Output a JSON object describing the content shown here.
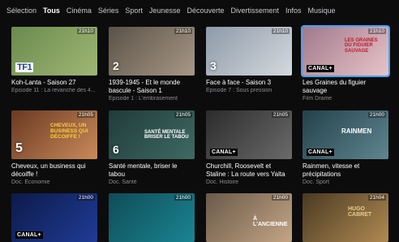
{
  "nav": [
    "Sélection",
    "Tous",
    "Cinéma",
    "Séries",
    "Sport",
    "Jeunesse",
    "Découverte",
    "Divertissement",
    "Infos",
    "Musique"
  ],
  "active_nav": "Tous",
  "cards": [
    {
      "time": "21h10",
      "channel": "TF1",
      "title": "Koh-Lanta - Saison 27",
      "subtitle": "Episode 11 : La revanche des 4...",
      "overlay": "",
      "colors": [
        "#6b8a4e",
        "#9fb774"
      ],
      "progress": 0
    },
    {
      "time": "21h10",
      "channel": "2",
      "title": "1939-1945 - Et le monde bascule - Saison 1",
      "subtitle": "Episode 1 : L'embrasement",
      "overlay": "",
      "colors": [
        "#5a5248",
        "#a89886"
      ],
      "progress": 0
    },
    {
      "time": "21h10",
      "channel": "3",
      "title": "Face à face - Saison 3",
      "subtitle": "Episode 7 : Sous pression",
      "overlay": "",
      "colors": [
        "#8d9aa8",
        "#d5d9df"
      ],
      "progress": 0
    },
    {
      "time": "21h10",
      "channel": "CANAL+",
      "title": "Les Graines du figuier sauvage",
      "subtitle": "Film Drame",
      "overlay": "Les graines du figuier sauvage",
      "colors": [
        "#a07a8a",
        "#e9c3c9"
      ],
      "progress": 0
    },
    {
      "time": "21h05",
      "channel": "5",
      "title": "Cheveux, un business qui décoiffe !",
      "subtitle": "Doc. Economie",
      "overlay": "Cheveux, un business qui décoiffe !",
      "colors": [
        "#6b3a22",
        "#c98a5a"
      ],
      "progress": 0
    },
    {
      "time": "21h05",
      "channel": "6",
      "title": "Santé mentale, briser le tabou",
      "subtitle": "Doc. Santé",
      "overlay": "Santé mentale briser le tabou",
      "colors": [
        "#213b3b",
        "#3e6a63"
      ],
      "progress": 0
    },
    {
      "time": "21h05",
      "channel": "CANAL+",
      "title": "Churchill, Roosevelt et Staline : La route vers Yalta",
      "subtitle": "Doc. Histoire",
      "overlay": "",
      "colors": [
        "#2c2c2c",
        "#6a6a6a"
      ],
      "progress": 0
    },
    {
      "time": "21h00",
      "channel": "CANAL+",
      "title": "Rainmen, vitesse et précipitations",
      "subtitle": "Doc. Sport",
      "overlay": "Rainmen",
      "colors": [
        "#24414a",
        "#5f8691"
      ],
      "progress": 0
    },
    {
      "time": "21h00",
      "channel": "CANAL+",
      "title": "",
      "subtitle": "",
      "overlay": "",
      "colors": [
        "#0d1a4a",
        "#1f3c96"
      ],
      "progress": 0
    },
    {
      "time": "21h00",
      "channel": "",
      "title": "",
      "subtitle": "",
      "overlay": "",
      "colors": [
        "#0f4c56",
        "#1a8592"
      ],
      "progress": 0
    },
    {
      "time": "21h00",
      "channel": "",
      "title": "",
      "subtitle": "",
      "overlay": "À l'ancienne",
      "colors": [
        "#6a5a4a",
        "#c4a584"
      ],
      "progress": 0
    },
    {
      "time": "21h04",
      "channel": "",
      "title": "",
      "subtitle": "",
      "overlay": "Hugo Cabret",
      "colors": [
        "#4a3a22",
        "#b08a52"
      ],
      "progress": 0
    }
  ],
  "channel_labels": {
    "tf1_t": "T",
    "tf1_f": "F",
    "tf1_1": "1"
  }
}
